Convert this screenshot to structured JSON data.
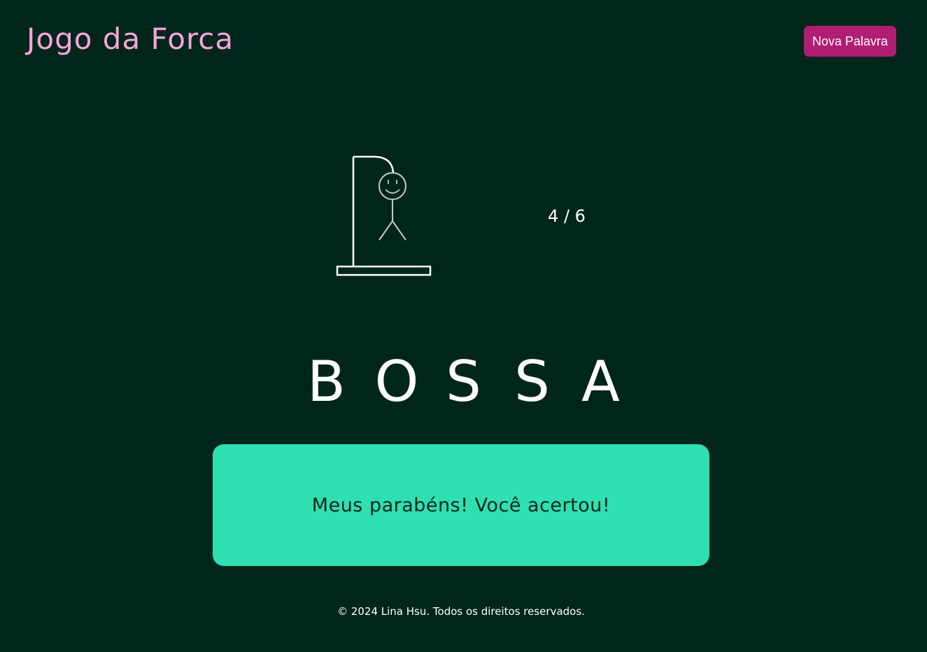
{
  "header": {
    "title": "Jogo da Forca",
    "new_word_label": "Nova Palavra"
  },
  "game": {
    "errors_label": "4 / 6",
    "errors": 4,
    "max_errors": 6,
    "word_letters": [
      "B",
      "O",
      "S",
      "S",
      "A"
    ],
    "result_message": "Meus parabéns! Você acertou!"
  },
  "footer": {
    "copyright": "© 2024 Lina Hsu. Todos os direitos reservados."
  },
  "colors": {
    "background": "#00261c",
    "title": "#f6a5d6",
    "button": "#b01e73",
    "result_box": "#2ee0b1"
  },
  "icons": {
    "gallows": "hangman-gallows-icon"
  }
}
